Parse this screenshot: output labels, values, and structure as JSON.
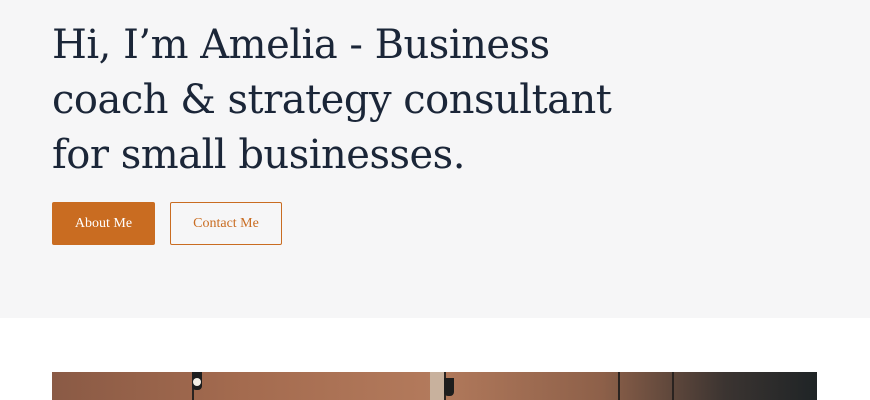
{
  "hero": {
    "title": "Hi, I’m Amelia - Business coach & strategy consultant for small businesses.",
    "primary_button": "About Me",
    "secondary_button": "Contact Me"
  },
  "colors": {
    "accent": "#c96c21",
    "heading": "#1b2638",
    "hero_background": "#f6f6f7"
  }
}
